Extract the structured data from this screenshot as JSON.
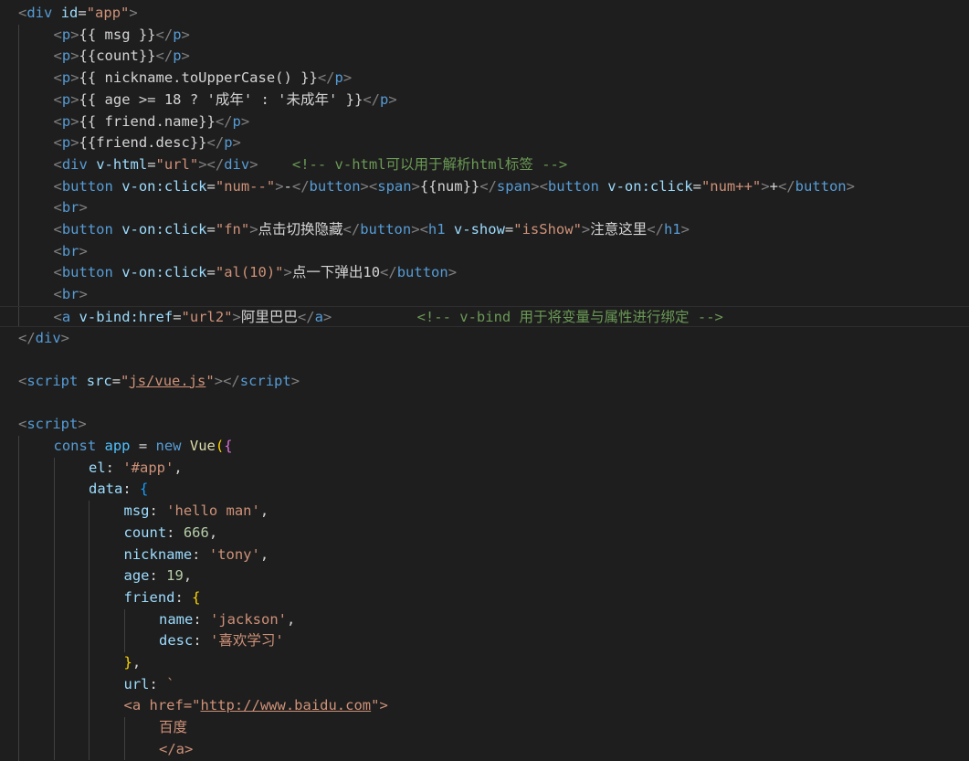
{
  "editor": {
    "language": "html",
    "theme": {
      "background": "#1e1e1e",
      "tag": "#569cd6",
      "punctuation": "#808080",
      "attribute": "#9cdcfe",
      "string": "#ce9178",
      "comment": "#6a9955",
      "number": "#b5cea8",
      "function": "#dcdcaa",
      "variable": "#4fc1ff",
      "bracket_1": "#ffd700",
      "bracket_2": "#da70d6",
      "bracket_3": "#179fff"
    },
    "lines": [
      {
        "indent": 0,
        "tokens": [
          [
            "p",
            "<"
          ],
          [
            "tag",
            "div"
          ],
          [
            "t",
            " "
          ],
          [
            "attr",
            "id"
          ],
          [
            "t",
            "="
          ],
          [
            "str",
            "\"app\""
          ],
          [
            "p",
            ">"
          ]
        ]
      },
      {
        "indent": 1,
        "tokens": [
          [
            "p",
            "<"
          ],
          [
            "tag",
            "p"
          ],
          [
            "p",
            ">"
          ],
          [
            "t",
            "{{ msg }}"
          ],
          [
            "p",
            "</"
          ],
          [
            "tag",
            "p"
          ],
          [
            "p",
            ">"
          ]
        ]
      },
      {
        "indent": 1,
        "tokens": [
          [
            "p",
            "<"
          ],
          [
            "tag",
            "p"
          ],
          [
            "p",
            ">"
          ],
          [
            "t",
            "{{count}}"
          ],
          [
            "p",
            "</"
          ],
          [
            "tag",
            "p"
          ],
          [
            "p",
            ">"
          ]
        ]
      },
      {
        "indent": 1,
        "tokens": [
          [
            "p",
            "<"
          ],
          [
            "tag",
            "p"
          ],
          [
            "p",
            ">"
          ],
          [
            "t",
            "{{ nickname.toUpperCase() }}"
          ],
          [
            "p",
            "</"
          ],
          [
            "tag",
            "p"
          ],
          [
            "p",
            ">"
          ]
        ]
      },
      {
        "indent": 1,
        "tokens": [
          [
            "p",
            "<"
          ],
          [
            "tag",
            "p"
          ],
          [
            "p",
            ">"
          ],
          [
            "t",
            "{{ age >= 18 ? '成年' : '未成年' }}"
          ],
          [
            "p",
            "</"
          ],
          [
            "tag",
            "p"
          ],
          [
            "p",
            ">"
          ]
        ]
      },
      {
        "indent": 1,
        "tokens": [
          [
            "p",
            "<"
          ],
          [
            "tag",
            "p"
          ],
          [
            "p",
            ">"
          ],
          [
            "t",
            "{{ friend.name}}"
          ],
          [
            "p",
            "</"
          ],
          [
            "tag",
            "p"
          ],
          [
            "p",
            ">"
          ]
        ]
      },
      {
        "indent": 1,
        "tokens": [
          [
            "p",
            "<"
          ],
          [
            "tag",
            "p"
          ],
          [
            "p",
            ">"
          ],
          [
            "t",
            "{{friend.desc}}"
          ],
          [
            "p",
            "</"
          ],
          [
            "tag",
            "p"
          ],
          [
            "p",
            ">"
          ]
        ]
      },
      {
        "indent": 1,
        "tokens": [
          [
            "p",
            "<"
          ],
          [
            "tag",
            "div"
          ],
          [
            "t",
            " "
          ],
          [
            "attr",
            "v-html"
          ],
          [
            "t",
            "="
          ],
          [
            "str",
            "\"url\""
          ],
          [
            "p",
            ">"
          ],
          [
            "p",
            "</"
          ],
          [
            "tag",
            "div"
          ],
          [
            "p",
            ">"
          ],
          [
            "t",
            "    "
          ],
          [
            "cmt",
            "<!-- v-html可以用于解析html标签 -->"
          ]
        ]
      },
      {
        "indent": 1,
        "tokens": [
          [
            "p",
            "<"
          ],
          [
            "tag",
            "button"
          ],
          [
            "t",
            " "
          ],
          [
            "attr",
            "v-on:click"
          ],
          [
            "t",
            "="
          ],
          [
            "str",
            "\"num--\""
          ],
          [
            "p",
            ">"
          ],
          [
            "t",
            "-"
          ],
          [
            "p",
            "</"
          ],
          [
            "tag",
            "button"
          ],
          [
            "p",
            ">"
          ],
          [
            "p",
            "<"
          ],
          [
            "tag",
            "span"
          ],
          [
            "p",
            ">"
          ],
          [
            "t",
            "{{num}}"
          ],
          [
            "p",
            "</"
          ],
          [
            "tag",
            "span"
          ],
          [
            "p",
            ">"
          ],
          [
            "p",
            "<"
          ],
          [
            "tag",
            "button"
          ],
          [
            "t",
            " "
          ],
          [
            "attr",
            "v-on:click"
          ],
          [
            "t",
            "="
          ],
          [
            "str",
            "\"num++\""
          ],
          [
            "p",
            ">"
          ],
          [
            "t",
            "+"
          ],
          [
            "p",
            "</"
          ],
          [
            "tag",
            "button"
          ],
          [
            "p",
            ">"
          ]
        ]
      },
      {
        "indent": 1,
        "tokens": [
          [
            "p",
            "<"
          ],
          [
            "tag",
            "br"
          ],
          [
            "p",
            ">"
          ]
        ]
      },
      {
        "indent": 1,
        "tokens": [
          [
            "p",
            "<"
          ],
          [
            "tag",
            "button"
          ],
          [
            "t",
            " "
          ],
          [
            "attr",
            "v-on:click"
          ],
          [
            "t",
            "="
          ],
          [
            "str",
            "\"fn\""
          ],
          [
            "p",
            ">"
          ],
          [
            "t",
            "点击切换隐藏"
          ],
          [
            "p",
            "</"
          ],
          [
            "tag",
            "button"
          ],
          [
            "p",
            ">"
          ],
          [
            "p",
            "<"
          ],
          [
            "tag",
            "h1"
          ],
          [
            "t",
            " "
          ],
          [
            "attr",
            "v-show"
          ],
          [
            "t",
            "="
          ],
          [
            "str",
            "\"isShow\""
          ],
          [
            "p",
            ">"
          ],
          [
            "t",
            "注意这里"
          ],
          [
            "p",
            "</"
          ],
          [
            "tag",
            "h1"
          ],
          [
            "p",
            ">"
          ]
        ]
      },
      {
        "indent": 1,
        "tokens": [
          [
            "p",
            "<"
          ],
          [
            "tag",
            "br"
          ],
          [
            "p",
            ">"
          ]
        ]
      },
      {
        "indent": 1,
        "tokens": [
          [
            "p",
            "<"
          ],
          [
            "tag",
            "button"
          ],
          [
            "t",
            " "
          ],
          [
            "attr",
            "v-on:click"
          ],
          [
            "t",
            "="
          ],
          [
            "str",
            "\"al(10)\""
          ],
          [
            "p",
            ">"
          ],
          [
            "t",
            "点一下弹出10"
          ],
          [
            "p",
            "</"
          ],
          [
            "tag",
            "button"
          ],
          [
            "p",
            ">"
          ]
        ]
      },
      {
        "indent": 1,
        "tokens": [
          [
            "p",
            "<"
          ],
          [
            "tag",
            "br"
          ],
          [
            "p",
            ">"
          ]
        ]
      },
      {
        "indent": 1,
        "current": true,
        "tokens": [
          [
            "p",
            "<"
          ],
          [
            "tag",
            "a"
          ],
          [
            "t",
            " "
          ],
          [
            "attr",
            "v-bind:href"
          ],
          [
            "t",
            "="
          ],
          [
            "str",
            "\"url2\""
          ],
          [
            "p",
            ">"
          ],
          [
            "t",
            "阿里巴巴"
          ],
          [
            "p",
            "</"
          ],
          [
            "tag",
            "a"
          ],
          [
            "p",
            ">"
          ],
          [
            "t",
            "          "
          ],
          [
            "cmt",
            "<!-- v-bind 用于将变量与属性进行绑定 -->"
          ]
        ]
      },
      {
        "indent": 0,
        "tokens": [
          [
            "p",
            "</"
          ],
          [
            "tag",
            "div"
          ],
          [
            "p",
            ">"
          ]
        ]
      },
      {
        "indent": 0,
        "tokens": []
      },
      {
        "indent": 0,
        "tokens": [
          [
            "p",
            "<"
          ],
          [
            "tag",
            "script"
          ],
          [
            "t",
            " "
          ],
          [
            "attr",
            "src"
          ],
          [
            "t",
            "="
          ],
          [
            "str",
            "\""
          ],
          [
            "strul",
            "js/vue.js"
          ],
          [
            "str",
            "\""
          ],
          [
            "p",
            ">"
          ],
          [
            "p",
            "</"
          ],
          [
            "tag",
            "script"
          ],
          [
            "p",
            ">"
          ]
        ]
      },
      {
        "indent": 0,
        "tokens": []
      },
      {
        "indent": 0,
        "tokens": [
          [
            "p",
            "<"
          ],
          [
            "tag",
            "script"
          ],
          [
            "p",
            ">"
          ]
        ]
      },
      {
        "indent": 1,
        "tokens": [
          [
            "kw",
            "const"
          ],
          [
            "t",
            " "
          ],
          [
            "var",
            "app"
          ],
          [
            "t",
            " = "
          ],
          [
            "kw",
            "new"
          ],
          [
            "t",
            " "
          ],
          [
            "fn",
            "Vue"
          ],
          [
            "br1",
            "("
          ],
          [
            "br2",
            "{"
          ]
        ]
      },
      {
        "indent": 2,
        "tokens": [
          [
            "prop",
            "el"
          ],
          [
            "t",
            ": "
          ],
          [
            "str",
            "'#app'"
          ],
          [
            "t",
            ","
          ]
        ]
      },
      {
        "indent": 2,
        "tokens": [
          [
            "prop",
            "data"
          ],
          [
            "t",
            ": "
          ],
          [
            "br3",
            "{"
          ]
        ]
      },
      {
        "indent": 3,
        "tokens": [
          [
            "prop",
            "msg"
          ],
          [
            "t",
            ": "
          ],
          [
            "str",
            "'hello man'"
          ],
          [
            "t",
            ","
          ]
        ]
      },
      {
        "indent": 3,
        "tokens": [
          [
            "prop",
            "count"
          ],
          [
            "t",
            ": "
          ],
          [
            "num",
            "666"
          ],
          [
            "t",
            ","
          ]
        ]
      },
      {
        "indent": 3,
        "tokens": [
          [
            "prop",
            "nickname"
          ],
          [
            "t",
            ": "
          ],
          [
            "str",
            "'tony'"
          ],
          [
            "t",
            ","
          ]
        ]
      },
      {
        "indent": 3,
        "tokens": [
          [
            "prop",
            "age"
          ],
          [
            "t",
            ": "
          ],
          [
            "num",
            "19"
          ],
          [
            "t",
            ","
          ]
        ]
      },
      {
        "indent": 3,
        "tokens": [
          [
            "prop",
            "friend"
          ],
          [
            "t",
            ": "
          ],
          [
            "br1",
            "{"
          ]
        ]
      },
      {
        "indent": 4,
        "tokens": [
          [
            "prop",
            "name"
          ],
          [
            "t",
            ": "
          ],
          [
            "str",
            "'jackson'"
          ],
          [
            "t",
            ","
          ]
        ]
      },
      {
        "indent": 4,
        "tokens": [
          [
            "prop",
            "desc"
          ],
          [
            "t",
            ": "
          ],
          [
            "str",
            "'喜欢学习'"
          ]
        ]
      },
      {
        "indent": 3,
        "tokens": [
          [
            "br1",
            "}"
          ],
          [
            "t",
            ","
          ]
        ]
      },
      {
        "indent": 3,
        "tokens": [
          [
            "prop",
            "url"
          ],
          [
            "t",
            ": "
          ],
          [
            "str",
            "`"
          ]
        ]
      },
      {
        "indent": 3,
        "tokens": [
          [
            "str",
            "<a href=\""
          ],
          [
            "strul",
            "http://www.baidu.com"
          ],
          [
            "str",
            "\">"
          ]
        ]
      },
      {
        "indent": 4,
        "tokens": [
          [
            "str",
            "百度"
          ]
        ]
      },
      {
        "indent": 4,
        "tokens": [
          [
            "str",
            "</a>"
          ]
        ]
      }
    ]
  }
}
